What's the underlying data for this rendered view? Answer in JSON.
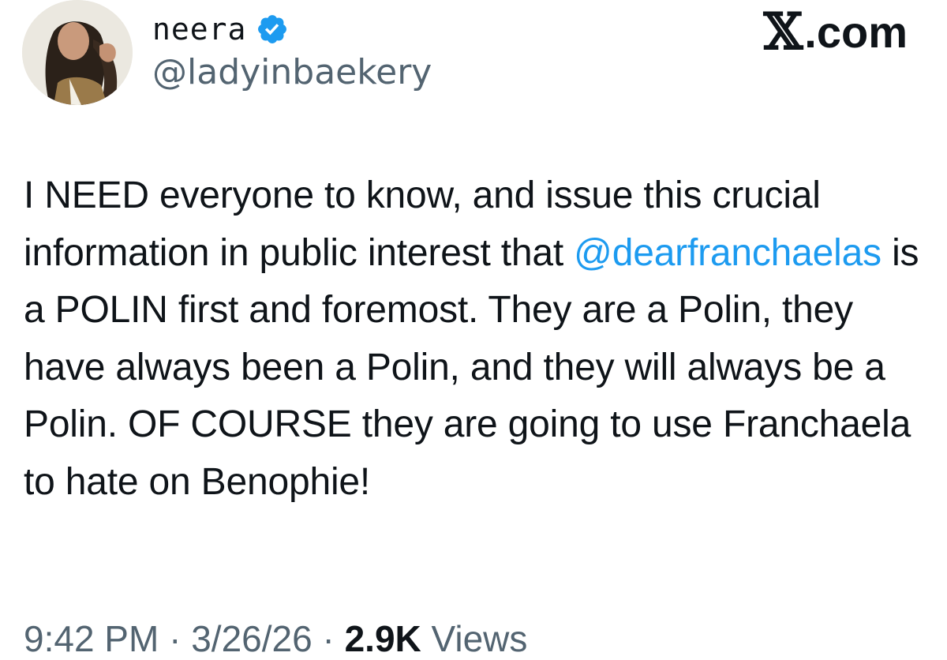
{
  "header": {
    "display_name": "neera",
    "handle": "@ladyinbaekery",
    "verified": true,
    "brand_letter": "X",
    "brand_domain": ".com"
  },
  "tweet": {
    "text_before": "I NEED everyone to know, and issue this crucial information in public interest that ",
    "mention": "@dearfranchaelas",
    "text_after": " is a POLIN first and foremost. They are a Polin, they have always been a Polin, and they will always be a Polin. OF COURSE they are going to use Franchaela to hate on Benophie!"
  },
  "meta": {
    "time": "9:42 PM",
    "separator": " · ",
    "date": "3/26/26",
    "views_count": "2.9K",
    "views_label": "Views"
  },
  "colors": {
    "text": "#0f1419",
    "secondary": "#536471",
    "link": "#1d9bf0",
    "verified": "#1d9bf0"
  },
  "icons": {
    "verified": "verified-badge-icon",
    "avatar": "profile-avatar"
  }
}
